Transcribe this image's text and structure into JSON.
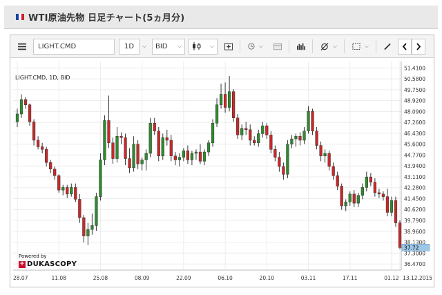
{
  "page": {
    "title": "WTI原油先物  日足チャート(5ヵ月分)",
    "flag_colors": [
      "#1f3fa3",
      "#ffffff",
      "#d0202c"
    ]
  },
  "toolbar": {
    "menu_icon": "hamburger-icon",
    "symbol": "LIGHT.CMD",
    "period": "1D",
    "side": "BID",
    "chart_type_icon": "candlestick-icon",
    "add_icon": "add-indicator-icon",
    "time_icon": "clock-icon",
    "calendar_icon": "calendar-icon",
    "volume_icon": "volume-bars-icon",
    "drawing_icon": "crosshair-icon",
    "select_icon": "select-area-icon",
    "pen_icon": "pen-icon",
    "prev_icon": "chevron-left-icon",
    "next_icon": "chevron-right-icon"
  },
  "chart": {
    "overlay_label": "LIGHT.CMD, 1D, BID",
    "powered_by": "Powered by",
    "brand": "DUKASCOPY",
    "last_price_label": "37.72"
  },
  "chart_data": {
    "type": "candlestick",
    "ylim": [
      36.0,
      51.9
    ],
    "y_ticks": [
      51.41,
      50.58,
      49.75,
      48.92,
      48.09,
      47.26,
      46.43,
      45.6,
      44.77,
      43.94,
      43.11,
      42.28,
      41.45,
      40.62,
      39.79,
      38.96,
      38.13,
      37.3,
      36.47
    ],
    "y_tick_labels": [
      "51.4100",
      "50.5800",
      "49.7500",
      "48.9200",
      "48.0900",
      "47.2600",
      "46.4300",
      "45.6000",
      "44.7700",
      "43.9400",
      "43.1100",
      "42.2800",
      "41.4500",
      "40.6200",
      "39.7900",
      "38.9600",
      "38.1300",
      "37.3000",
      "36.4700"
    ],
    "x_tick_labels": [
      "28.07",
      "11.08",
      "25.08",
      "08.09",
      "22.09",
      "06.10",
      "20.10",
      "03.11",
      "17.11",
      "01.12",
      "13.12.2015"
    ],
    "x_tick_index": [
      0,
      10,
      20,
      30,
      40,
      50,
      60,
      70,
      80,
      90,
      100
    ],
    "colors": {
      "up": "#2e8b2e",
      "down": "#c8282a",
      "wick": "#333333"
    },
    "candles": [
      [
        47.3,
        48.3,
        46.9,
        47.9
      ],
      [
        47.9,
        49.4,
        47.6,
        49.0
      ],
      [
        49.0,
        49.2,
        48.3,
        48.6
      ],
      [
        48.6,
        48.7,
        47.0,
        47.3
      ],
      [
        47.3,
        47.5,
        45.5,
        45.9
      ],
      [
        45.9,
        46.2,
        45.2,
        45.4
      ],
      [
        45.4,
        45.7,
        44.9,
        45.2
      ],
      [
        45.2,
        45.4,
        43.9,
        44.2
      ],
      [
        44.2,
        44.4,
        43.4,
        43.7
      ],
      [
        43.7,
        43.9,
        42.9,
        43.2
      ],
      [
        43.2,
        43.3,
        41.9,
        42.1
      ],
      [
        42.1,
        42.5,
        41.7,
        42.3
      ],
      [
        42.3,
        42.5,
        41.5,
        41.8
      ],
      [
        41.8,
        42.6,
        41.6,
        42.3
      ],
      [
        42.3,
        42.6,
        41.2,
        41.4
      ],
      [
        41.4,
        41.8,
        39.6,
        40.0
      ],
      [
        40.0,
        40.2,
        38.1,
        38.6
      ],
      [
        38.6,
        39.6,
        37.9,
        39.1
      ],
      [
        39.1,
        40.3,
        38.7,
        39.4
      ],
      [
        39.4,
        41.9,
        39.0,
        41.6
      ],
      [
        41.6,
        44.9,
        41.3,
        44.4
      ],
      [
        44.4,
        47.8,
        44.0,
        47.4
      ],
      [
        47.4,
        49.3,
        45.3,
        45.7
      ],
      [
        45.7,
        46.1,
        44.1,
        44.5
      ],
      [
        44.5,
        46.9,
        44.2,
        46.2
      ],
      [
        46.2,
        46.5,
        45.6,
        46.1
      ],
      [
        46.1,
        46.4,
        44.0,
        44.5
      ],
      [
        44.5,
        45.3,
        43.4,
        43.8
      ],
      [
        43.8,
        46.2,
        43.5,
        45.6
      ],
      [
        45.6,
        45.9,
        43.7,
        44.1
      ],
      [
        44.1,
        44.6,
        43.6,
        44.4
      ],
      [
        44.4,
        45.2,
        43.6,
        44.9
      ],
      [
        44.9,
        47.6,
        44.6,
        47.2
      ],
      [
        47.2,
        47.6,
        46.3,
        46.6
      ],
      [
        46.6,
        46.9,
        44.3,
        44.7
      ],
      [
        44.7,
        46.4,
        44.4,
        46.1
      ],
      [
        46.1,
        46.7,
        45.5,
        45.9
      ],
      [
        45.9,
        46.3,
        44.3,
        44.7
      ],
      [
        44.7,
        45.0,
        44.0,
        44.4
      ],
      [
        44.4,
        44.9,
        43.9,
        44.6
      ],
      [
        44.6,
        45.3,
        44.3,
        45.1
      ],
      [
        45.1,
        45.5,
        44.1,
        44.4
      ],
      [
        44.4,
        45.1,
        44.0,
        44.9
      ],
      [
        44.9,
        45.2,
        44.4,
        45.0
      ],
      [
        45.0,
        45.6,
        44.1,
        44.3
      ],
      [
        44.3,
        45.2,
        44.0,
        45.0
      ],
      [
        45.0,
        45.9,
        44.7,
        45.7
      ],
      [
        45.7,
        47.5,
        45.4,
        47.2
      ],
      [
        47.2,
        49.1,
        46.9,
        48.6
      ],
      [
        48.6,
        50.2,
        48.3,
        49.4
      ],
      [
        49.4,
        50.3,
        48.0,
        48.4
      ],
      [
        48.4,
        50.8,
        48.1,
        49.6
      ],
      [
        49.6,
        49.8,
        47.3,
        47.6
      ],
      [
        47.6,
        47.9,
        46.0,
        46.3
      ],
      [
        46.3,
        47.1,
        45.9,
        46.8
      ],
      [
        46.8,
        47.3,
        46.3,
        46.7
      ],
      [
        46.7,
        47.1,
        45.5,
        45.9
      ],
      [
        45.9,
        46.2,
        45.5,
        45.7
      ],
      [
        45.7,
        46.7,
        45.4,
        46.4
      ],
      [
        46.4,
        47.3,
        46.1,
        47.0
      ],
      [
        47.0,
        47.2,
        46.0,
        46.3
      ],
      [
        46.3,
        46.6,
        44.9,
        45.2
      ],
      [
        45.2,
        45.5,
        44.3,
        44.6
      ],
      [
        44.6,
        45.0,
        43.5,
        43.9
      ],
      [
        43.9,
        44.2,
        42.9,
        43.3
      ],
      [
        43.3,
        45.9,
        43.0,
        45.6
      ],
      [
        45.6,
        46.3,
        45.3,
        46.0
      ],
      [
        46.0,
        46.4,
        45.4,
        46.2
      ],
      [
        46.2,
        46.5,
        45.5,
        45.9
      ],
      [
        45.9,
        46.9,
        45.6,
        46.6
      ],
      [
        46.6,
        48.5,
        46.4,
        48.1
      ],
      [
        48.1,
        48.3,
        46.3,
        46.6
      ],
      [
        46.6,
        46.9,
        45.2,
        45.5
      ],
      [
        45.5,
        45.8,
        44.3,
        44.7
      ],
      [
        44.7,
        45.2,
        44.2,
        44.9
      ],
      [
        44.9,
        45.1,
        43.6,
        43.9
      ],
      [
        43.9,
        44.2,
        42.9,
        43.2
      ],
      [
        43.2,
        43.5,
        42.1,
        42.4
      ],
      [
        42.4,
        42.6,
        40.6,
        40.9
      ],
      [
        40.9,
        41.4,
        40.5,
        41.2
      ],
      [
        41.2,
        42.0,
        40.9,
        41.8
      ],
      [
        41.8,
        42.1,
        40.8,
        41.1
      ],
      [
        41.1,
        41.9,
        40.8,
        41.7
      ],
      [
        41.7,
        42.6,
        41.4,
        42.3
      ],
      [
        42.3,
        43.5,
        42.0,
        43.1
      ],
      [
        43.1,
        43.4,
        42.4,
        42.7
      ],
      [
        42.7,
        43.0,
        41.6,
        41.9
      ],
      [
        41.9,
        42.2,
        41.5,
        41.8
      ],
      [
        41.8,
        42.0,
        41.3,
        41.6
      ],
      [
        41.6,
        42.2,
        40.1,
        40.4
      ],
      [
        40.4,
        41.6,
        40.1,
        41.3
      ],
      [
        41.3,
        41.6,
        39.3,
        39.6
      ],
      [
        39.6,
        39.8,
        37.6,
        37.72
      ]
    ]
  }
}
